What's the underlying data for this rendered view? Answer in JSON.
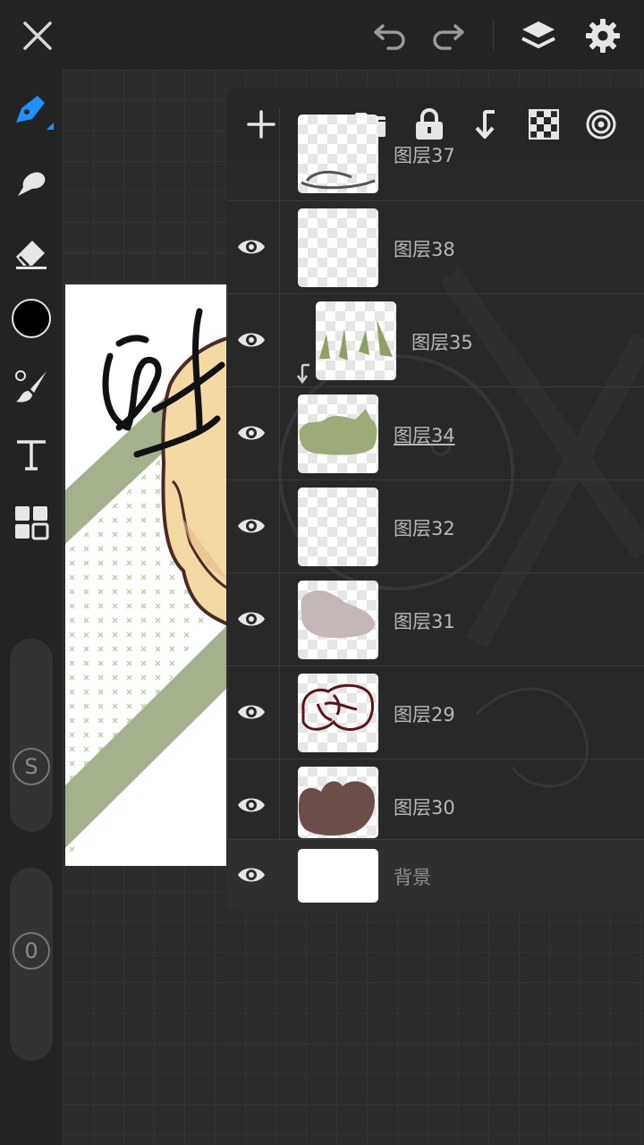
{
  "topbar": {
    "close": "close-icon",
    "undo": "undo-icon",
    "redo": "redo-icon",
    "layers": "layers-icon",
    "settings": "gear-icon"
  },
  "left_toolbar": {
    "tools": [
      "pen-icon",
      "smudge-icon",
      "eraser-icon",
      "color-swatch",
      "brush-icon",
      "text-icon",
      "gallery-icon"
    ],
    "brush_color": "#000000",
    "accent": "#1e90ff",
    "size_label": "S",
    "opacity_label": "0"
  },
  "layer_panel": {
    "toolbar": [
      "add-icon",
      "folder-icon",
      "lock-icon",
      "merge-down-icon",
      "checker-icon",
      "blend-mode-icon"
    ],
    "partial_layer": {
      "name": "图层37"
    },
    "layers": [
      {
        "name": "图层38",
        "visible": true
      },
      {
        "name": "图层35",
        "visible": true,
        "clipped": true
      },
      {
        "name": "图层34",
        "visible": true,
        "active": true
      },
      {
        "name": "图层32",
        "visible": true
      },
      {
        "name": "图层31",
        "visible": true
      },
      {
        "name": "图层29",
        "visible": true
      },
      {
        "name": "图层30",
        "visible": true
      },
      {
        "name": "背景",
        "visible": true
      }
    ]
  },
  "colors": {
    "bar_bg": "#232323",
    "panel_bg": "#282828",
    "stripe_green": "#a3b28c",
    "skin": "#f3d9a4",
    "outline": "#4a2a26"
  }
}
